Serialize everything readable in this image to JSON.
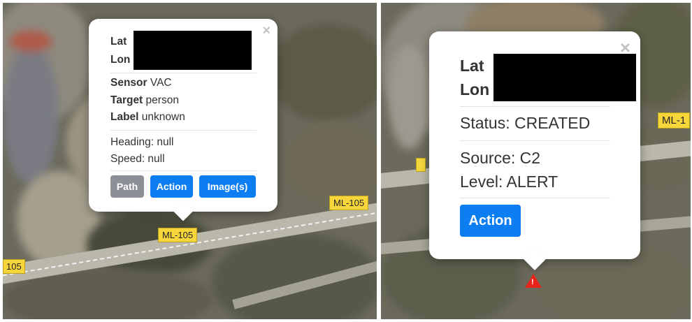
{
  "left_map": {
    "road_labels": [
      "ML-105",
      "ML-105",
      "105"
    ],
    "popup": {
      "close_glyph": "×",
      "lat_label": "Lat",
      "lon_label": "Lon",
      "sensor_label": "Sensor",
      "sensor_value": "VAC",
      "target_label": "Target",
      "target_value": "person",
      "label_label": "Label",
      "label_value": "unknown",
      "heading": "Heading: null",
      "speed": "Speed: null",
      "buttons": {
        "path": "Path",
        "action": "Action",
        "images": "Image(s)"
      }
    }
  },
  "right_map": {
    "road_labels": [
      "ML-1"
    ],
    "popup": {
      "close_glyph": "×",
      "lat_label": "Lat",
      "lon_label": "Lon",
      "status": "Status: CREATED",
      "source": "Source: C2",
      "level": "Level: ALERT",
      "buttons": {
        "action": "Action"
      }
    },
    "marker": {
      "type": "alert-triangle",
      "glyph": "!",
      "color": "#e8231b"
    }
  },
  "colors": {
    "button_blue": "#0d7df2",
    "button_gray": "#8c9096",
    "road_label_bg": "#f7d63c"
  }
}
